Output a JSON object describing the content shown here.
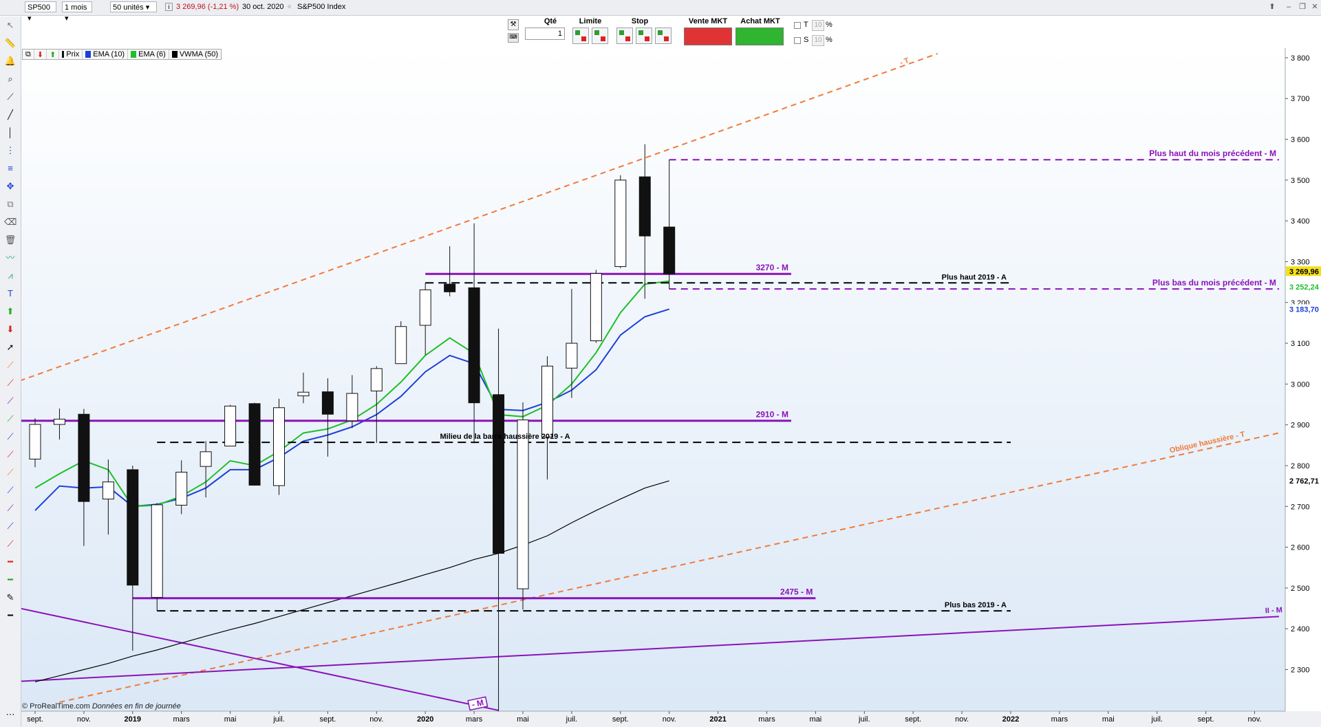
{
  "topbar": {
    "symbol": "SP500",
    "period": "1 mois",
    "units": "50 unités",
    "info_icon": "info-icon",
    "quote": "3 269,96 (-1,21 %)",
    "date": "30 oct. 2020",
    "index_name": "S&P500 Index"
  },
  "order_panel": {
    "qty_label": "Qté",
    "qty_value": "1",
    "limit_label": "Limite",
    "stop_label": "Stop",
    "sell_label": "Vente MKT",
    "buy_label": "Achat MKT",
    "t_label": "T",
    "s_label": "S",
    "t_value": "10",
    "s_value": "10",
    "pct": "%"
  },
  "legend": {
    "prix": "Prix",
    "ema10": "EMA (10)",
    "ema6": "EMA (6)",
    "vwma": "VWMA (50)"
  },
  "footer": {
    "brand": "© ProRealTime.com",
    "note": "Données en fin de journée"
  },
  "colors": {
    "ema10": "#1c3fd8",
    "ema6": "#1fbf2a",
    "vwma": "#000000",
    "purple": "#8a12b8",
    "orange": "#f07a3a",
    "bull": "#ffffff",
    "bear": "#111111"
  },
  "chart_data": {
    "type": "candlestick",
    "timeframe": "monthly",
    "y_axis": {
      "min": 2230,
      "max": 3810,
      "ticks": [
        2300,
        2400,
        2500,
        2600,
        2700,
        2800,
        2900,
        3000,
        3100,
        3200,
        3300,
        3400,
        3500,
        3600,
        3700,
        3800
      ],
      "tick_labels": [
        "2 300",
        "2 400",
        "2 500",
        "2 600",
        "2 700",
        "2 800",
        "2 900",
        "3 000",
        "3 100",
        "3 200",
        "3 300",
        "3 400",
        "3 500",
        "3 600",
        "3 700",
        "3 800"
      ]
    },
    "x_axis": {
      "labels": [
        "sept.",
        "nov.",
        "2019",
        "mars",
        "mai",
        "juil.",
        "sept.",
        "nov.",
        "2020",
        "mars",
        "mai",
        "juil.",
        "sept.",
        "nov.",
        "2021",
        "mars",
        "mai",
        "juil.",
        "sept.",
        "nov.",
        "2022",
        "mars",
        "mai",
        "juil.",
        "sept.",
        "nov."
      ],
      "label_index": [
        0,
        2,
        4,
        6,
        8,
        10,
        12,
        14,
        16,
        18,
        20,
        22,
        24,
        26,
        28,
        30,
        32,
        34,
        36,
        38,
        40,
        42,
        44,
        46,
        48,
        50
      ],
      "bold": [
        "2019",
        "2020",
        "2021",
        "2022"
      ]
    },
    "candles": [
      {
        "date": "2018-08",
        "o": 2816,
        "h": 2916,
        "l": 2796,
        "c": 2901
      },
      {
        "date": "2018-09",
        "o": 2901,
        "h": 2940,
        "l": 2864,
        "c": 2914
      },
      {
        "date": "2018-10",
        "o": 2926,
        "h": 2939,
        "l": 2603,
        "c": 2712
      },
      {
        "date": "2018-11",
        "o": 2718,
        "h": 2815,
        "l": 2631,
        "c": 2760
      },
      {
        "date": "2018-12",
        "o": 2790,
        "h": 2800,
        "l": 2346,
        "c": 2507
      },
      {
        "date": "2019-01",
        "o": 2477,
        "h": 2708,
        "l": 2444,
        "c": 2704
      },
      {
        "date": "2019-02",
        "o": 2703,
        "h": 2813,
        "l": 2681,
        "c": 2784
      },
      {
        "date": "2019-03",
        "o": 2798,
        "h": 2860,
        "l": 2722,
        "c": 2834
      },
      {
        "date": "2019-04",
        "o": 2848,
        "h": 2949,
        "l": 2848,
        "c": 2946
      },
      {
        "date": "2019-05",
        "o": 2952,
        "h": 2954,
        "l": 2751,
        "c": 2752
      },
      {
        "date": "2019-06",
        "o": 2751,
        "h": 2964,
        "l": 2728,
        "c": 2942
      },
      {
        "date": "2019-07",
        "o": 2971,
        "h": 3028,
        "l": 2953,
        "c": 2980
      },
      {
        "date": "2019-08",
        "o": 2981,
        "h": 3014,
        "l": 2822,
        "c": 2926
      },
      {
        "date": "2019-09",
        "o": 2910,
        "h": 3022,
        "l": 2892,
        "c": 2977
      },
      {
        "date": "2019-10",
        "o": 2983,
        "h": 3044,
        "l": 2856,
        "c": 3038
      },
      {
        "date": "2019-11",
        "o": 3050,
        "h": 3154,
        "l": 3050,
        "c": 3141
      },
      {
        "date": "2019-12",
        "o": 3144,
        "h": 3248,
        "l": 3071,
        "c": 3231
      },
      {
        "date": "2020-01",
        "o": 3245,
        "h": 3338,
        "l": 3215,
        "c": 3226
      },
      {
        "date": "2020-02",
        "o": 3236,
        "h": 3394,
        "l": 2855,
        "c": 2954
      },
      {
        "date": "2020-03",
        "o": 2974,
        "h": 3136,
        "l": 2192,
        "c": 2585
      },
      {
        "date": "2020-04",
        "o": 2498,
        "h": 2955,
        "l": 2447,
        "c": 2912
      },
      {
        "date": "2020-05",
        "o": 2870,
        "h": 3068,
        "l": 2766,
        "c": 3044
      },
      {
        "date": "2020-06",
        "o": 3039,
        "h": 3233,
        "l": 2966,
        "c": 3100
      },
      {
        "date": "2020-07",
        "o": 3106,
        "h": 3280,
        "l": 3101,
        "c": 3271
      },
      {
        "date": "2020-08",
        "o": 3288,
        "h": 3512,
        "l": 3284,
        "c": 3500
      },
      {
        "date": "2020-09",
        "o": 3508,
        "h": 3588,
        "l": 3209,
        "c": 3363
      },
      {
        "date": "2020-10",
        "o": 3385,
        "h": 3550,
        "l": 3233,
        "c": 3270
      }
    ],
    "series": [
      {
        "name": "EMA (10)",
        "color": "#1c3fd8",
        "values": [
          2690,
          2750,
          2745,
          2748,
          2700,
          2705,
          2720,
          2745,
          2790,
          2790,
          2820,
          2860,
          2875,
          2895,
          2925,
          2970,
          3030,
          3070,
          3050,
          2938,
          2935,
          2955,
          2985,
          3035,
          3120,
          3165,
          3183.7
        ]
      },
      {
        "name": "EMA (6)",
        "color": "#1fbf2a",
        "values": [
          2745,
          2780,
          2812,
          2790,
          2700,
          2703,
          2725,
          2760,
          2812,
          2800,
          2835,
          2880,
          2890,
          2912,
          2950,
          3005,
          3070,
          3113,
          3075,
          2925,
          2920,
          2948,
          3000,
          3077,
          3175,
          3245,
          3252.24
        ]
      },
      {
        "name": "VWMA (50)",
        "color": "#000000",
        "values": [
          2270,
          2285,
          2300,
          2315,
          2333,
          2348,
          2365,
          2382,
          2398,
          2413,
          2430,
          2447,
          2464,
          2481,
          2498,
          2515,
          2533,
          2550,
          2570,
          2585,
          2605,
          2628,
          2660,
          2690,
          2718,
          2745,
          2762.71
        ]
      }
    ],
    "price_tags": [
      {
        "value": 3269.96,
        "label": "3 269,96",
        "color": "#f4e01a"
      },
      {
        "value": 3252.24,
        "label": "3 252,24",
        "color": "#1fbf2a"
      },
      {
        "value": 3183.7,
        "label": "3 183,70",
        "color": "#1c3fd8"
      },
      {
        "value": 2762.71,
        "label": "2 762,71",
        "color": "#000000"
      }
    ],
    "annotations": [
      {
        "label": "3270 - M",
        "value": 3270,
        "from": 16,
        "to": 31,
        "style": "solid",
        "color": "#8a12b8"
      },
      {
        "label": "2910 - M",
        "value": 2910,
        "from": -1,
        "to": 31,
        "style": "solid",
        "color": "#8a12b8"
      },
      {
        "label": "2475 - M",
        "value": 2475,
        "from": 4,
        "to": 32,
        "style": "solid",
        "color": "#8a12b8"
      },
      {
        "label": "Plus haut 2019 - A",
        "value": 3248,
        "from": 16,
        "to": 40,
        "style": "dashed",
        "color": "#000000"
      },
      {
        "label": "Milieu de la barre haussière 2019 - A",
        "value": 2857,
        "from": 5,
        "to": 40,
        "style": "dashed",
        "color": "#000000"
      },
      {
        "label": "Plus bas 2019 - A",
        "value": 2444,
        "from": 5,
        "to": 40,
        "style": "dashed",
        "color": "#000000"
      },
      {
        "label": "Plus haut du mois précédent - M",
        "value": 3550,
        "from": 26,
        "to": 51,
        "style": "dashed",
        "color": "#8a12b8"
      },
      {
        "label": "Plus bas du mois précédent - M",
        "value": 3233,
        "from": 26,
        "to": 51,
        "style": "dashed",
        "color": "#8a12b8"
      }
    ],
    "trendlines": [
      {
        "label": "- T",
        "p1": [
          -1,
          3000
        ],
        "p2": [
          37,
          3810
        ],
        "style": "dashed",
        "color": "#f07a3a"
      },
      {
        "label": "Oblique haussière - T",
        "p1": [
          1,
          2220
        ],
        "p2": [
          51,
          2880
        ],
        "style": "dashed",
        "color": "#f07a3a"
      },
      {
        "label": "II - M",
        "p1": [
          -1,
          2270
        ],
        "p2": [
          51,
          2430
        ],
        "style": "solid",
        "color": "#8a12b8"
      },
      {
        "label": "- M",
        "p1": [
          -1,
          2455
        ],
        "p2": [
          19,
          2200
        ],
        "style": "solid",
        "color": "#8a12b8"
      }
    ]
  }
}
